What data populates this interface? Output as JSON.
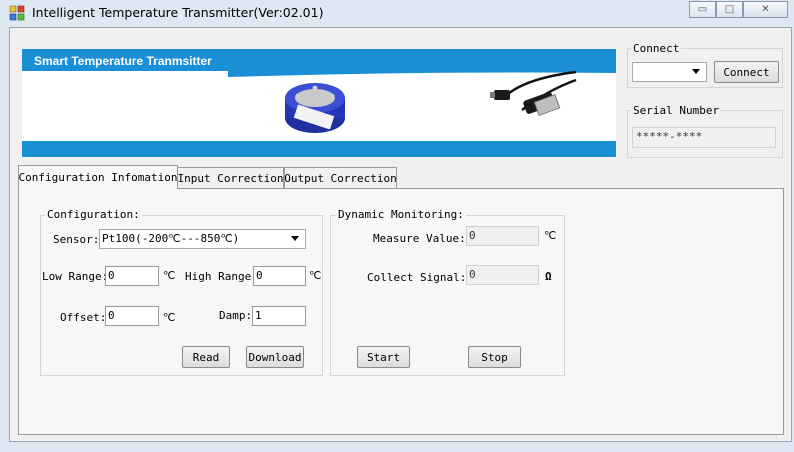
{
  "window": {
    "title": "Intelligent Temperature Transmitter(Ver:02.01)",
    "minimize_glyph": "▭",
    "maximize_glyph": "□",
    "close_glyph": "✕"
  },
  "banner": {
    "title": "Smart Temperature Tranmsitter"
  },
  "connect": {
    "group_label": "Connect",
    "port_value": "",
    "button_label": "Connect"
  },
  "serial": {
    "group_label": "Serial Number",
    "value": "*****-****"
  },
  "tabs": [
    {
      "label": "Configuration Infomation",
      "active": true
    },
    {
      "label": "Input Correction",
      "active": false
    },
    {
      "label": "Output Correction",
      "active": false
    }
  ],
  "configuration": {
    "group_label": "Configuration:",
    "sensor_label": "Sensor:",
    "sensor_value": "Pt100(-200℃---850℃)",
    "low_range_label": "Low Range:",
    "low_range_value": "0",
    "low_range_unit": "℃",
    "high_range_label": "High Range:",
    "high_range_value": "0",
    "high_range_unit": "℃",
    "offset_label": "Offset:",
    "offset_value": "0",
    "offset_unit": "℃",
    "damp_label": "Damp:",
    "damp_value": "1",
    "read_label": "Read",
    "download_label": "Download"
  },
  "monitoring": {
    "group_label": "Dynamic Monitoring:",
    "measure_label": "Measure Value:",
    "measure_value": "0",
    "measure_unit": "℃",
    "signal_label": "Collect Signal:",
    "signal_value": "0",
    "signal_unit": "Ω",
    "start_label": "Start",
    "stop_label": "Stop"
  },
  "icons": {
    "app": "app-icon",
    "transmitter": "transmitter-image",
    "usb": "usb-cable-image"
  },
  "colors": {
    "accent_blue": "#1a8fd6",
    "window_frame": "#dde8f3",
    "panel": "#f0f0f0"
  }
}
